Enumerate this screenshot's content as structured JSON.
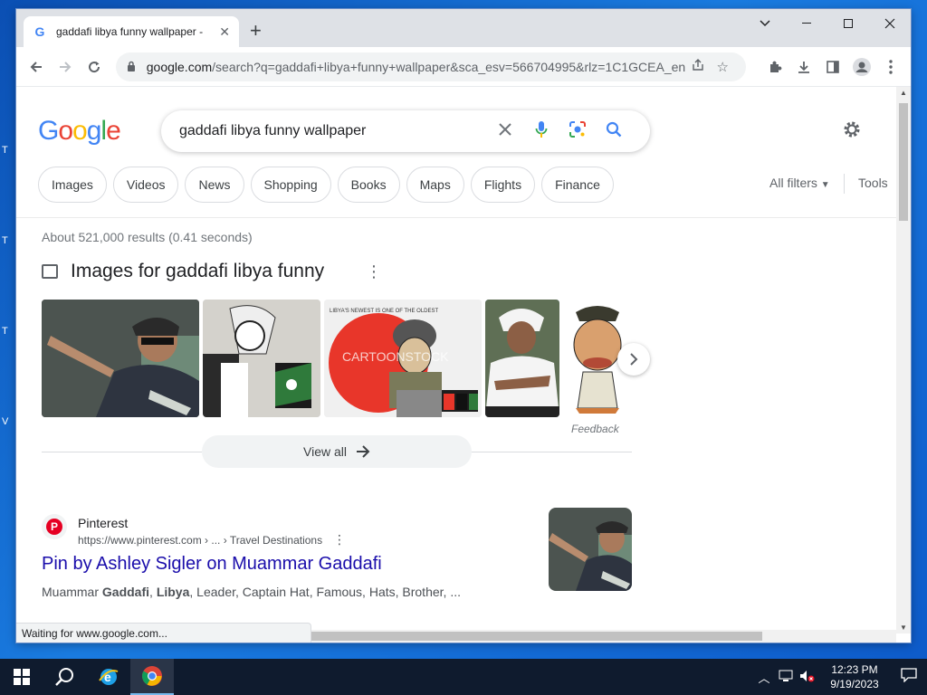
{
  "colors": {
    "brand_blue": "#4285f4",
    "brand_red": "#ea4335",
    "brand_yellow": "#fbbc05",
    "brand_green": "#34a853",
    "link": "#1a0dab",
    "pinterest": "#e60023"
  },
  "browser": {
    "tab_title": "gaddafi libya funny wallpaper - ",
    "tab_favicon": "G",
    "url_host": "google.com",
    "url_rest": "/search?q=gaddafi+libya+funny+wallpaper&sca_esv=566704995&rlz=1C1GCEA_en...",
    "status_text": "Waiting for www.google.com..."
  },
  "search": {
    "logo": [
      "G",
      "o",
      "o",
      "g",
      "l",
      "e"
    ],
    "query": "gaddafi libya funny wallpaper",
    "chips": [
      "Images",
      "Videos",
      "News",
      "Shopping",
      "Books",
      "Maps",
      "Flights",
      "Finance"
    ],
    "all_filters": "All filters",
    "tools": "Tools",
    "result_stats": "About 521,000 results (0.41 seconds)"
  },
  "images_block": {
    "title": "Images for gaddafi libya funny",
    "feedback": "Feedback",
    "view_all": "View all",
    "thumb2_caption": "LIBYA'S NEWEST IS ONE OF THE OLDEST",
    "thumb2_watermark": "CARTOONSTOCK"
  },
  "result": {
    "site_name": "Pinterest",
    "site_url": "https://www.pinterest.com › ... › Travel Destinations",
    "title": "Pin by Ashley Sigler on Muammar Gaddafi",
    "snippet_prefix": "Muammar ",
    "snippet_b1": "Gaddafi",
    "snippet_sep": ", ",
    "snippet_b2": "Libya",
    "snippet_rest": ", Leader, Captain Hat, Famous, Hats, Brother, ..."
  },
  "taskbar": {
    "time": "12:23 PM",
    "date": "9/19/2023"
  }
}
